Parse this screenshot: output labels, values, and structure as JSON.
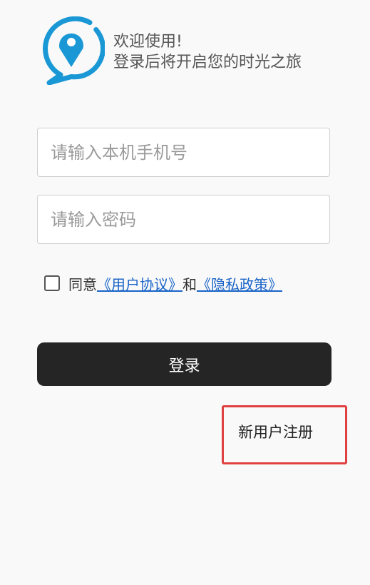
{
  "welcome": {
    "title": "欢迎使用!",
    "subtitle": "登录后将开启您的时光之旅"
  },
  "form": {
    "phone_placeholder": "请输入本机手机号",
    "password_placeholder": "请输入密码"
  },
  "agreement": {
    "prefix": "同意",
    "user_agreement": "《用户协议》",
    "conjunction": "和",
    "privacy_policy": "《隐私政策》",
    "checked": false
  },
  "actions": {
    "login_label": "登录",
    "register_label": "新用户注册"
  },
  "colors": {
    "brand": "#1a98d5",
    "link": "#1a64c8",
    "button_bg": "#252525",
    "highlight": "#e04040"
  },
  "icons": {
    "logo": "location-pin-chat-icon"
  }
}
